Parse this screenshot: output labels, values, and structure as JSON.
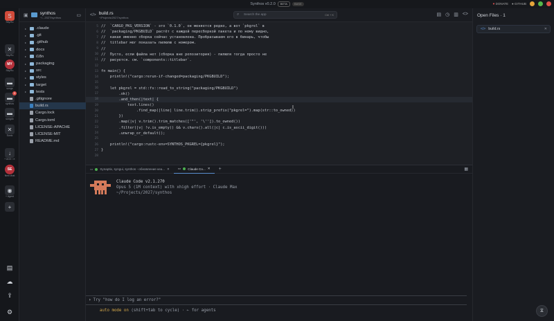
{
  "titlebar": {
    "title": "Synthos v0.2.0",
    "badge": "BETA",
    "badge2": "BASE",
    "donate": "DONATE",
    "github": "GITHUB"
  },
  "rail": [
    {
      "label": "Sky.Ru",
      "icon": "S"
    },
    {
      "label": "Sky.Ru",
      "icon": "✕"
    },
    {
      "label": "Sky.Ru",
      "icon": "MY"
    },
    {
      "label": "songs",
      "icon": "▬"
    },
    {
      "label": "synthos",
      "icon": "▬",
      "badge": "3"
    },
    {
      "label": "songdo",
      "icon": "▬"
    },
    {
      "label": "Sonic",
      "icon": "✕"
    },
    {
      "label": "+ AG3 / ✕",
      "icon": "↓"
    },
    {
      "label": "New chat",
      "icon": "SE"
    },
    {
      "label": "+ Agent",
      "icon": "◉"
    },
    {
      "label": "",
      "icon": "+"
    }
  ],
  "project": {
    "name": "synthos",
    "path": "~/...2027/synthos"
  },
  "tree": [
    {
      "name": ".claude",
      "type": "folder"
    },
    {
      "name": ".git",
      "type": "folder"
    },
    {
      "name": ".github",
      "type": "folder"
    },
    {
      "name": "docs",
      "type": "folder"
    },
    {
      "name": "i18n",
      "type": "folder"
    },
    {
      "name": "packaging",
      "type": "folder"
    },
    {
      "name": "src",
      "type": "folder"
    },
    {
      "name": "styles",
      "type": "folder"
    },
    {
      "name": "target",
      "type": "folder"
    },
    {
      "name": "tests",
      "type": "folder"
    },
    {
      "name": ".gitignore",
      "type": "file"
    },
    {
      "name": "build.rs",
      "type": "file",
      "selected": true
    },
    {
      "name": "Cargo.lock",
      "type": "file"
    },
    {
      "name": "Cargo.toml",
      "type": "file"
    },
    {
      "name": "LICENSE-APACHE",
      "type": "file"
    },
    {
      "name": "LICENSE-MIT",
      "type": "file"
    },
    {
      "name": "README.md",
      "type": "file"
    }
  ],
  "editor_tab": {
    "name": "build.rs",
    "path": "~/Projects/2027/synthos"
  },
  "search": {
    "placeholder": "Search the app",
    "shortcut": "Ctrl + K"
  },
  "code": [
    {
      "n": "5",
      "t": "//  `CARGO_PKG_VERSION` - это `0.1.0`, он меняется редко, а вот `pkgrel` в",
      "cls": "cm"
    },
    {
      "n": "6",
      "t": "//  `packaging/PKGBUILD` растёт с каждой пересборкой пакета и по нему видно,",
      "cls": "cm"
    },
    {
      "n": "7",
      "t": "//  какая именно сборка сейчас установлена. Пробрасываем его в бинарь, чтобы",
      "cls": "cm"
    },
    {
      "n": "8",
      "t": "//  titlebar мог показать пилюлю с номером.",
      "cls": "cm"
    },
    {
      "n": "9",
      "t": "//",
      "cls": "cm"
    },
    {
      "n": "10",
      "t": "//  Пусто, если файла нет (сборка вне репозитория) - пилюля тогда просто не",
      "cls": "cm"
    },
    {
      "n": "11",
      "t": "//  рисуется. см. `components::titlebar`.",
      "cls": "cm"
    },
    {
      "n": "12",
      "t": "",
      "cls": ""
    },
    {
      "n": "13",
      "t": "fn main() {",
      "cls": "kw"
    },
    {
      "n": "14",
      "t": "    println!(\"cargo:rerun-if-changed=packaging/PKGBUILD\");",
      "cls": "fn"
    },
    {
      "n": "15",
      "t": "",
      "cls": ""
    },
    {
      "n": "16",
      "t": "    let pkgrel = std::fs::read_to_string(\"packaging/PKGBUILD\")",
      "cls": "c"
    },
    {
      "n": "17",
      "t": "        .ok()",
      "cls": "c"
    },
    {
      "n": "18",
      "t": "        .and_then(|text| {",
      "cls": "c",
      "hl": true
    },
    {
      "n": "19",
      "t": "            text.lines()",
      "cls": "c"
    },
    {
      "n": "20",
      "t": "                .find_map(|line| line.trim().strip_prefix(\"pkgrel=\").map(str::to_owned))",
      "cls": "c"
    },
    {
      "n": "21",
      "t": "        })",
      "cls": "c"
    },
    {
      "n": "22",
      "t": "        .map(|v| v.trim().trim_matches(['\"', '\\'']).to_owned())",
      "cls": "c"
    },
    {
      "n": "23",
      "t": "        .filter(|v| !v.is_empty() && v.chars().all(|c| c.is_ascii_digit()))",
      "cls": "c"
    },
    {
      "n": "24",
      "t": "        .unwrap_or_default();",
      "cls": "c"
    },
    {
      "n": "25",
      "t": "",
      "cls": ""
    },
    {
      "n": "26",
      "t": "    println!(\"cargo:rustc-env=SYNTHOS_PKGREL={pkgrel}\");",
      "cls": "fn"
    },
    {
      "n": "27",
      "t": "}",
      "cls": "c"
    },
    {
      "n": "28",
      "t": "",
      "cls": ""
    }
  ],
  "open_files": {
    "title": "Open Files · 1",
    "items": [
      "build.rs"
    ]
  },
  "terminal": {
    "tab1": "Synaptix, syngui, synthos - обновление кеа...",
    "tab2": "Claude Co...",
    "cc_title": "Claude Code v2.1.270",
    "cc_sub1": "Opus 5 (1M context) with xhigh effort · Claude Max",
    "cc_sub2": "~/Projects/2027/synthos",
    "prompt": "Try \"how do I log an error?\"",
    "mode_prefix": "auto mode",
    "mode_on": "on",
    "mode_suffix": "(shift+tab to cycle) · ← for agents"
  },
  "colors": {
    "accent": "#5a8fd0",
    "brand": "#d04a3a",
    "on": "#d4a84b"
  }
}
